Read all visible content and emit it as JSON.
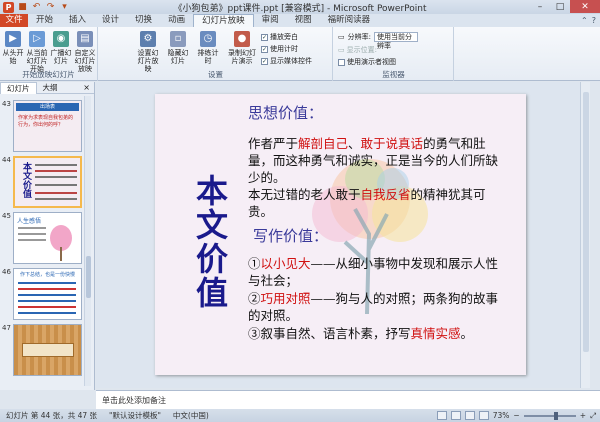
{
  "window": {
    "title": "《小狗包弟》ppt课件.ppt [兼容模式] - Microsoft PowerPoint",
    "minimize": "–",
    "maximize": "□",
    "close": "✕",
    "app_icon_letter": "P"
  },
  "tabs": [
    "文件",
    "开始",
    "插入",
    "设计",
    "切换",
    "动画",
    "幻灯片放映",
    "审阅",
    "视图",
    "福昕阅读器"
  ],
  "ribbon": {
    "group1": {
      "label": "开始放映幻灯片",
      "buttons": [
        "从头开始",
        "从当前幻灯片开始",
        "广播幻灯片",
        "自定义幻灯片放映"
      ]
    },
    "group2": {
      "label": "设置",
      "buttons": [
        "设置幻灯片放映",
        "隐藏幻灯片",
        "排练计时",
        "录制幻灯片演示"
      ],
      "checks": [
        "播放旁白",
        "使用计时",
        "显示媒体控件"
      ]
    },
    "group3": {
      "label": "监视器",
      "resolution_label": "分辨率:",
      "resolution_value": "使用当前分辨率",
      "show_on_label": "显示位置:",
      "presenter_view": "使用演示者视图"
    }
  },
  "leftpane": {
    "tab_slides": "幻灯片",
    "tab_outline": "大纲",
    "close": "×",
    "thumbnails": [
      {
        "num": "43",
        "title": "出场表",
        "text": "作家为求表现自我包弟的行为，你出何的呼？"
      },
      {
        "num": "44",
        "title": "本文价值"
      },
      {
        "num": "45",
        "title": "人生感悟"
      },
      {
        "num": "46",
        "title": "作下总结，也是一份快慢"
      },
      {
        "num": "47",
        "title": ""
      }
    ]
  },
  "slide": {
    "vertical_title": "本文价值",
    "heading1": "思想价值：",
    "p1_pre": "作者严于",
    "p1_red1": "解剖自己",
    "p1_mid": "、",
    "p1_red2": "敢于说真话",
    "p1_post": "的勇气和肚量，而这种勇气和诚实，正是当今的人们所缺少的。",
    "p2_pre": "本无过错的老人敢于",
    "p2_red": "自我反省",
    "p2_post": "的精神犹其可贵。",
    "heading2": "写作价值：",
    "item1_num": "①",
    "item1_red": "以小见大",
    "item1_rest": "——从细小事物中发现和展示人性与社会；",
    "item2_num": "②",
    "item2_red": "巧用对照",
    "item2_rest": "——狗与人的对照；两条狗的故事的对照。",
    "item3_pre": "③叙事自然、语言朴素，抒写",
    "item3_red": "真情实感",
    "item3_post": "。"
  },
  "notes": {
    "placeholder": "单击此处添加备注"
  },
  "status": {
    "slide_info": "幻灯片 第 44 张，共 47 张",
    "theme": "\"默认设计模板\"",
    "language": "中文(中国)",
    "zoom": "73%"
  },
  "colors": {
    "accent": "#d24726",
    "title_blue": "#1a1a8c",
    "highlight": "#d01010"
  }
}
